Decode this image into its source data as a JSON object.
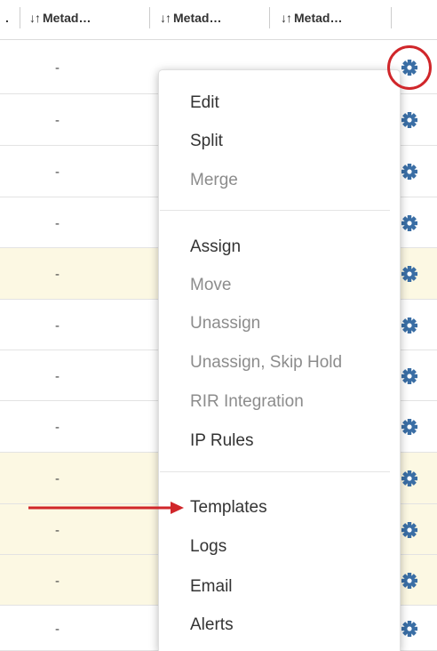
{
  "table": {
    "columns": [
      {
        "label": "."
      },
      {
        "label": "Metad…",
        "sort_icon": "sort-icon"
      },
      {
        "label": "Metad…",
        "sort_icon": "sort-icon"
      },
      {
        "label": "Metad…",
        "sort_icon": "sort-icon"
      }
    ],
    "sort_glyph": "↓↑",
    "rows": [
      {
        "value": "-"
      },
      {
        "value": "-"
      },
      {
        "value": "-"
      },
      {
        "value": "-"
      },
      {
        "value": "-"
      },
      {
        "value": "-"
      },
      {
        "value": "-"
      },
      {
        "value": "-"
      },
      {
        "value": "-"
      },
      {
        "value": "-"
      },
      {
        "value": "-"
      },
      {
        "value": "-"
      }
    ],
    "row_action_icon": "gear-icon"
  },
  "context_menu": {
    "groups": [
      [
        {
          "label": "Edit",
          "enabled": true
        },
        {
          "label": "Split",
          "enabled": true
        },
        {
          "label": "Merge",
          "enabled": false
        }
      ],
      [
        {
          "label": "Assign",
          "enabled": true
        },
        {
          "label": "Move",
          "enabled": false
        },
        {
          "label": "Unassign",
          "enabled": false
        },
        {
          "label": "Unassign, Skip Hold",
          "enabled": false
        },
        {
          "label": "RIR Integration",
          "enabled": false
        },
        {
          "label": "IP Rules",
          "enabled": true
        }
      ],
      [
        {
          "label": "Templates",
          "enabled": true
        },
        {
          "label": "Logs",
          "enabled": true
        },
        {
          "label": "Email",
          "enabled": true
        },
        {
          "label": "Alerts",
          "enabled": true
        }
      ]
    ]
  },
  "annotations": {
    "circle_color": "#d0262a",
    "arrow_color": "#d0262a",
    "arrow_target": "Templates"
  },
  "colors": {
    "row_highlight": "#fcf8e3",
    "gear_icon": "#3a6ea5",
    "disabled_text": "#8c8c8c"
  }
}
